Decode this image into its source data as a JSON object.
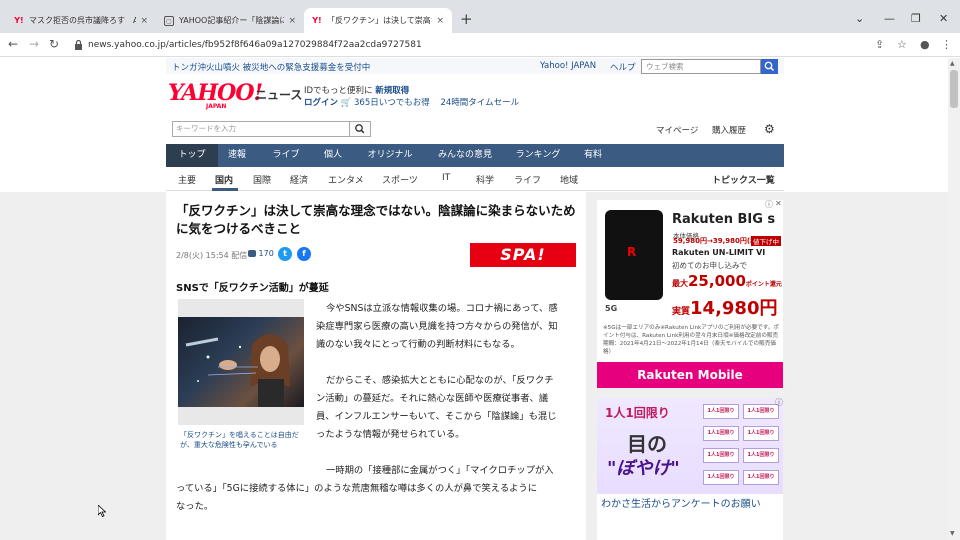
{
  "browser": {
    "tabs": [
      {
        "label": "マスク拒否の呉市議降ろす　AIRDO",
        "favicon": "Y!"
      },
      {
        "label": "YAHOO記事紹介ー「陰謀論に染",
        "favicon": ""
      },
      {
        "label": "「反ワクチン」は決して崇高な理念で",
        "favicon": "Y!"
      }
    ],
    "close_glyph": "×",
    "new_tab_glyph": "+",
    "url": "news.yahoo.co.jp/articles/fb952f8f646a09a127029884f72aa2cda9727581",
    "window_controls": {
      "dropdown": "⌄",
      "minimize": "—",
      "restore": "❐",
      "close": "✕"
    },
    "nav_icons": {
      "back": "←",
      "forward": "→",
      "reload": "↻"
    },
    "tool_icons": {
      "share": "⇪",
      "star": "☆",
      "profile": "●",
      "menu": "⋮"
    }
  },
  "site": {
    "alert": "トンガ沖火山噴火 被災地への緊急支援募金を受付中",
    "top_links": {
      "yahoo_japan": "Yahoo! JAPAN",
      "help": "ヘルプ"
    },
    "web_search_placeholder": "ウェブ検索",
    "logo": {
      "yahoo": "YAHOO!",
      "japan": "JAPAN",
      "news": "ニュース"
    },
    "promo": {
      "line1_prefix": "IDでもっと便利に",
      "line1_link": "新規取得",
      "login": "ログイン",
      "shop": "365日いつでもお得",
      "timesale": "24時間タイムセール"
    },
    "keyword_placeholder": "キーワードを入力",
    "right_links": {
      "mypage": "マイページ",
      "history": "購入履歴"
    },
    "main_nav": [
      "トップ",
      "速報",
      "ライブ",
      "個人",
      "オリジナル",
      "みんなの意見",
      "ランキング",
      "有料"
    ],
    "sub_nav": [
      "主要",
      "国内",
      "国際",
      "経済",
      "エンタメ",
      "スポーツ",
      "IT",
      "科学",
      "ライフ",
      "地域"
    ],
    "topics_link": "トピックス一覧"
  },
  "article": {
    "headline": "「反ワクチン」は決して崇高な理念ではない。陰謀論に染まらないために気をつけるべきこと",
    "date": "2/8(火) 15:54 配信",
    "comment_count": "170",
    "source_logo": "SPA!",
    "section_title": "SNSで「反ワクチン活動」が蔓延",
    "photo_caption": "「反ワクチン」を唱えることは自由だが、重大な危険性も孕んでいる",
    "para1": [
      "今やSNSは立派な情報収集の場。コロナ禍にあって、感",
      "染症専門家ら医療の高い見識を持つ方々からの発信が、知",
      "識のない我々にとって行動の判断材料にもなる。"
    ],
    "para2": [
      "だからこそ、感染拡大とともに心配なのが、「反ワクチ",
      "ン活動」の蔓延だ。それに熱心な医師や医療従事者、議",
      "員、インフルエンサーもいて、そこから「陰謀論」も混じ",
      "ったような情報が発せられている。"
    ],
    "para3": [
      "一時期の「接種部に金属がつく」「マイクロチップが入",
      "っている」「5Gに接続する体に」のような荒唐無稽な噂は多くの人が鼻で笑えるように",
      "なった。"
    ]
  },
  "ads": {
    "rakuten": {
      "title": "Rakuten BIG s",
      "list_price_label": "本体価格",
      "list_price": "59,980円→39,980円(税込)",
      "badge": "値下げ中",
      "plan": "Rakuten UN-LIMIT VI",
      "plan_sub": "初めてのお申し込みで",
      "points_prefix": "最大",
      "points": "25,000",
      "points_suffix": "ポイント還元",
      "real_prefix": "実質",
      "real_price": "14,980円",
      "fine_print": "※5Gは一部エリアのみ※Rakuten Linkアプリのご利用が必要です。ポイント付与は、Rakuten Link利用の翌々月末日頃※価格改定前の販売期間：2021年4月21日〜2022年1月14日（楽天モバイルでの販売価格）",
      "footer": "Rakuten Mobile",
      "fiveg": "5G",
      "phone_logo": "R"
    },
    "wakasa": {
      "headline1": "1人1回限り",
      "headline2": "目の",
      "headline3": "\"ぼやけ\"",
      "pill": "1人1回限り",
      "text": "わかさ生活からアンケートのお願い"
    },
    "close_glyph": "✕",
    "info_glyph": "ⓘ"
  }
}
